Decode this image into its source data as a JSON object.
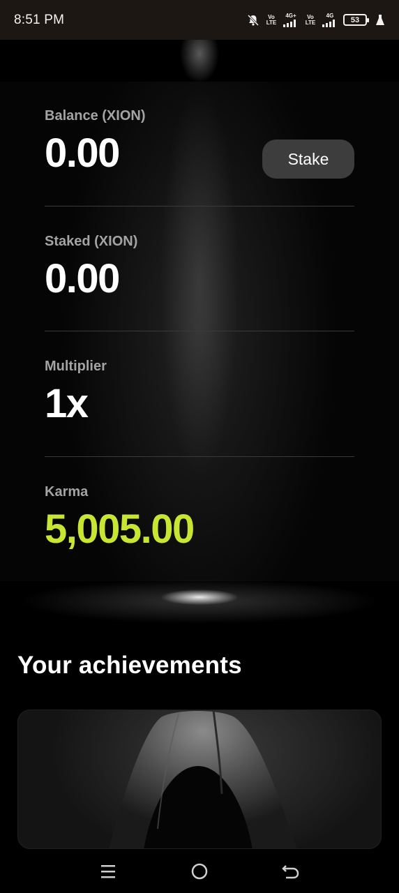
{
  "status_bar": {
    "time": "8:51 PM",
    "battery": "53",
    "sim1": "Vo LTE",
    "sim1_net": "4G+",
    "sim2": "Vo LTE",
    "sim2_net": "4G",
    "icons": [
      "mute-bell-icon",
      "signal-icon",
      "battery-icon",
      "flask-icon"
    ]
  },
  "balance": {
    "label": "Balance (XION)",
    "value": "0.00",
    "button_label": "Stake"
  },
  "staked": {
    "label": "Staked (XION)",
    "value": "0.00"
  },
  "multiplier": {
    "label": "Multiplier",
    "value": "1x"
  },
  "karma": {
    "label": "Karma",
    "value": "5,005.00"
  },
  "achievements": {
    "title": "Your achievements"
  },
  "colors": {
    "accent_green": "#c7e533",
    "button_bg": "#3d3d3d",
    "label_gray": "#a4a4a4"
  },
  "nav_bar": {
    "icons": [
      "menu-icon",
      "home-icon",
      "back-icon"
    ]
  }
}
